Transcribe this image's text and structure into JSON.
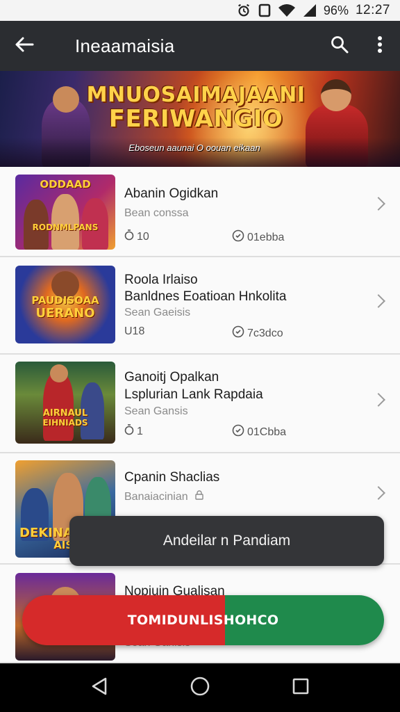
{
  "status_bar": {
    "battery": "96%",
    "time": "12:27"
  },
  "app_bar": {
    "title": "Ineaamaisia",
    "icons": [
      "arrow-back-icon",
      "search-icon",
      "more-vert-icon"
    ]
  },
  "banner": {
    "title_line1": "MNUOSAIMAJAANI",
    "title_line2": "FERIWANGIO",
    "subtitle": "Eboseun aaunai O oouan eikaan"
  },
  "list": {
    "items": [
      {
        "thumb_text": "ODDAAD",
        "thumb_text2": "RODNMLPANS",
        "title": "Abanin Ogidkan",
        "title2": "",
        "subtitle": "Bean conssa",
        "meta_left": "10",
        "meta_right": "01ebba"
      },
      {
        "thumb_text": "PAUDISOAA",
        "thumb_text2": "UERANO",
        "title": "Roola Irlaiso",
        "title2": "Banldnes Eoatioan Hnkolita",
        "subtitle": "Sean Gaeisis",
        "meta_left": "U18",
        "meta_right": "7c3dco"
      },
      {
        "thumb_text": "AIRNAUL",
        "thumb_text2": "EIHNIADS",
        "title": "Ganoitj Opalkan",
        "title2": "Lsplurian Lank Rapdaia",
        "subtitle": "Sean Gansis",
        "meta_left": "1",
        "meta_right": "01Cbba"
      },
      {
        "thumb_text": "DEKINA",
        "thumb_text2": "AISI",
        "title": "Cpanin Shaclias",
        "title2": "",
        "subtitle": "Banaiacinian",
        "meta_left": "",
        "meta_right": ""
      },
      {
        "thumb_text": "",
        "thumb_text2": "",
        "title": "Nopiuin Gualisan",
        "title2": "",
        "subtitle": "Sean Ganisis",
        "meta_left": "",
        "meta_right": ""
      }
    ]
  },
  "toast": {
    "message": "Andeilar n Pandiam"
  },
  "cta": {
    "label": "TOMIDUNLISHOHCO"
  },
  "colors": {
    "app_bar": "#2b2d31",
    "cta_red": "#d62a2a",
    "cta_green": "#1f8a4c"
  }
}
